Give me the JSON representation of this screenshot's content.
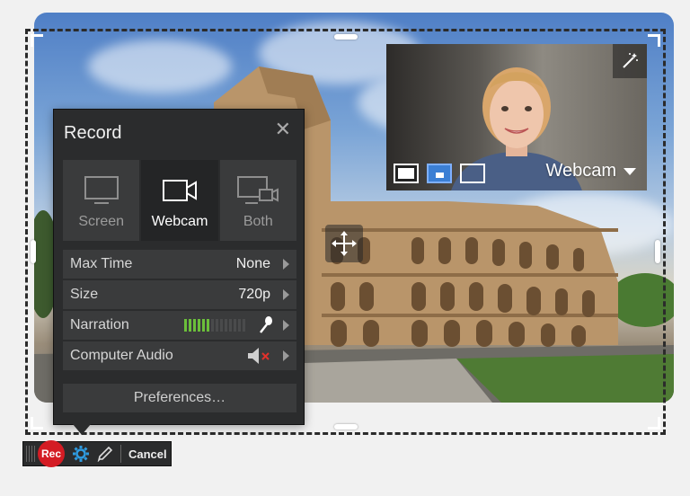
{
  "panel": {
    "title": "Record",
    "modes": [
      {
        "label": "Screen",
        "icon": "monitor-icon",
        "active": false
      },
      {
        "label": "Webcam",
        "icon": "webcam-icon",
        "active": true
      },
      {
        "label": "Both",
        "icon": "screen-and-webcam-icon",
        "active": false
      }
    ],
    "settings": [
      {
        "label": "Max Time",
        "value": "None"
      },
      {
        "label": "Size",
        "value": "720p"
      },
      {
        "label": "Narration",
        "value": "",
        "icon": "microphone-icon",
        "level_bars_on": 6,
        "level_bars_total": 14
      },
      {
        "label": "Computer Audio",
        "value": "",
        "icon": "speaker-muted-icon"
      }
    ],
    "preferences_label": "Preferences…"
  },
  "webcam": {
    "label": "Webcam",
    "size_buttons": [
      "small-size-icon",
      "medium-size-icon",
      "full-size-icon"
    ]
  },
  "toolbar": {
    "rec_label": "Rec",
    "cancel_label": "Cancel"
  },
  "colors": {
    "panel_bg": "#2b2c2d",
    "row_bg": "#3a3b3c",
    "rec_red": "#d41c24",
    "level_green": "#6bbf3a",
    "gear_blue": "#2f9be0",
    "muted_red": "#e0312b"
  }
}
